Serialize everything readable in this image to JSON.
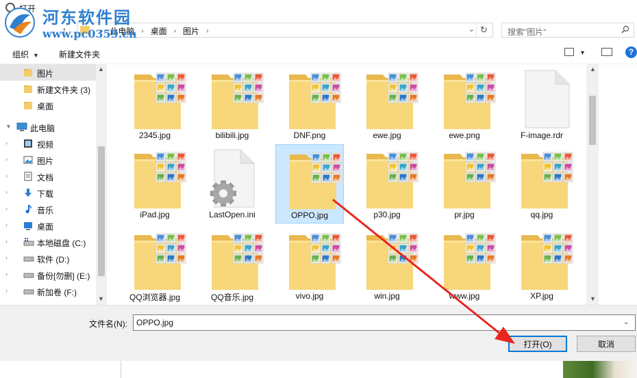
{
  "window": {
    "title": "打开"
  },
  "watermark": {
    "text": "河东软件园",
    "url": "www.pc0359.cn"
  },
  "address": {
    "breadcrumbs": [
      "此电脑",
      "桌面",
      "图片"
    ],
    "search_placeholder": "搜索\"图片\""
  },
  "toolbar": {
    "organize_label": "组织",
    "new_folder_label": "新建文件夹",
    "help_label": "?"
  },
  "sidebar": {
    "items": [
      {
        "label": "图片",
        "icon": "folder-icon",
        "selected": true
      },
      {
        "label": "新建文件夹 (3)",
        "icon": "folder-icon"
      },
      {
        "label": "桌面",
        "icon": "folder-icon"
      },
      {
        "label": "此电脑",
        "icon": "computer-icon"
      },
      {
        "label": "视频",
        "icon": "video-icon"
      },
      {
        "label": "图片",
        "icon": "pictures-icon"
      },
      {
        "label": "文档",
        "icon": "document-icon"
      },
      {
        "label": "下载",
        "icon": "download-icon"
      },
      {
        "label": "音乐",
        "icon": "music-icon"
      },
      {
        "label": "桌面",
        "icon": "desktop-icon"
      },
      {
        "label": "本地磁盘 (C:)",
        "icon": "drive-windows-icon"
      },
      {
        "label": "软件 (D:)",
        "icon": "drive-icon"
      },
      {
        "label": "备份[勿删] (E:)",
        "icon": "drive-icon"
      },
      {
        "label": "新加卷 (F:)",
        "icon": "drive-icon"
      }
    ]
  },
  "files": [
    {
      "name": "2345.jpg",
      "type": "image-folder"
    },
    {
      "name": "bilibili.jpg",
      "type": "image-folder"
    },
    {
      "name": "DNF.png",
      "type": "image-folder"
    },
    {
      "name": "ewe.jpg",
      "type": "image-folder"
    },
    {
      "name": "ewe.png",
      "type": "image-folder"
    },
    {
      "name": "F-image.rdr",
      "type": "blank-file"
    },
    {
      "name": "iPad.jpg",
      "type": "image-folder"
    },
    {
      "name": "LastOpen.ini",
      "type": "settings-file"
    },
    {
      "name": "OPPO.jpg",
      "type": "image-folder",
      "selected": true
    },
    {
      "name": "p30.jpg",
      "type": "image-folder"
    },
    {
      "name": "pr.jpg",
      "type": "image-folder"
    },
    {
      "name": "qq.jpg",
      "type": "image-folder"
    },
    {
      "name": "QQ浏览器.jpg",
      "type": "image-folder"
    },
    {
      "name": "QQ音乐.jpg",
      "type": "image-folder"
    },
    {
      "name": "vivo.jpg",
      "type": "image-folder"
    },
    {
      "name": "win.jpg",
      "type": "image-folder"
    },
    {
      "name": "www.jpg",
      "type": "image-folder"
    },
    {
      "name": "XP.jpg",
      "type": "image-folder"
    }
  ],
  "bottom": {
    "filename_label": "文件名(N):",
    "filename_value": "OPPO.jpg",
    "open_label": "打开(O)",
    "cancel_label": "取消"
  },
  "colors": {
    "accent": "#0078d7",
    "annotation_arrow": "#e8261f",
    "selection": "#cce8ff"
  }
}
